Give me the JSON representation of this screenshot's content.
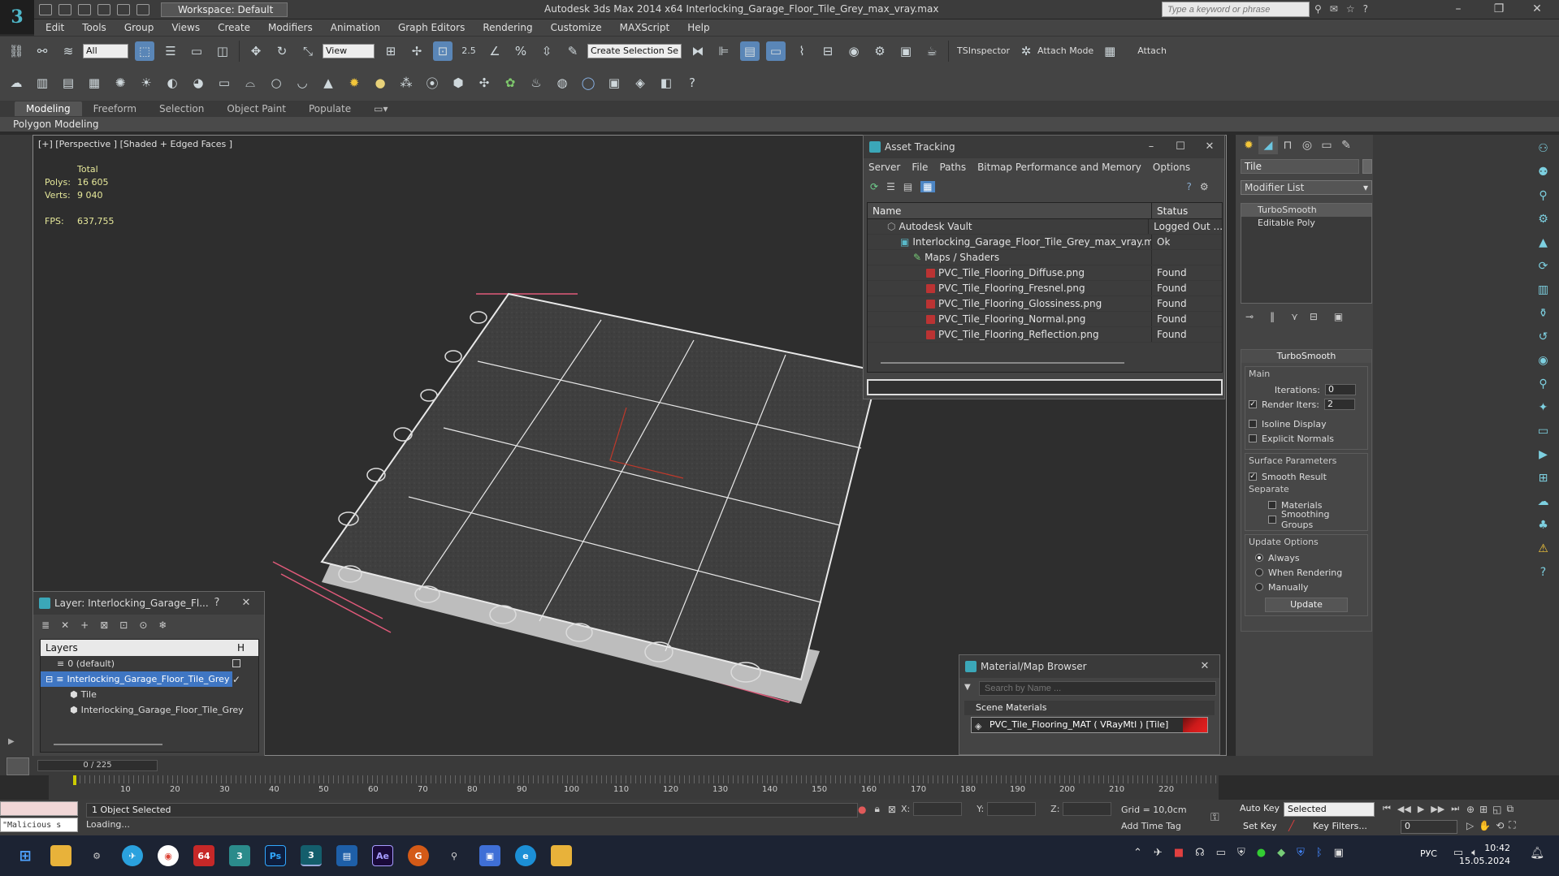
{
  "app": {
    "title": "Autodesk 3ds Max  2014 x64    Interlocking_Garage_Floor_Tile_Grey_max_vray.max",
    "workspace": "Workspace: Default",
    "search_placeholder": "Type a keyword or phrase"
  },
  "menu": [
    "Edit",
    "Tools",
    "Group",
    "Views",
    "Create",
    "Modifiers",
    "Animation",
    "Graph Editors",
    "Rendering",
    "Customize",
    "MAXScript",
    "Help"
  ],
  "toolbar": {
    "selection_filter": "All",
    "ref_coord": "View",
    "named_selection": "Create Selection Se",
    "snap_label": "2.5",
    "tsinspector": "TSInspector",
    "attach_mode": "Attach Mode",
    "attach": "Attach"
  },
  "ribbon": {
    "tabs": [
      "Modeling",
      "Freeform",
      "Selection",
      "Object Paint",
      "Populate"
    ],
    "active": "Modeling",
    "panel": "Polygon Modeling"
  },
  "viewport": {
    "label": "[+] [Perspective ] [Shaded + Edged Faces ]",
    "stats": {
      "header": "Total",
      "polys_label": "Polys:",
      "polys": "16 605",
      "verts_label": "Verts:",
      "verts": "9 040",
      "fps_label": "FPS:",
      "fps": "637,755"
    }
  },
  "asset_tracking": {
    "title": "Asset Tracking",
    "menu": [
      "Server",
      "File",
      "Paths",
      "Bitmap Performance and Memory",
      "Options"
    ],
    "columns": [
      "Name",
      "Status"
    ],
    "rows": [
      {
        "name": "Autodesk Vault",
        "status": "Logged Out ...",
        "indent": 1,
        "icon": "vault-icon"
      },
      {
        "name": "Interlocking_Garage_Floor_Tile_Grey_max_vray.max",
        "status": "Ok",
        "indent": 2,
        "icon": "max-file-icon"
      },
      {
        "name": "Maps / Shaders",
        "status": "",
        "indent": 3,
        "icon": "maps-icon"
      },
      {
        "name": "PVC_Tile_Flooring_Diffuse.png",
        "status": "Found",
        "indent": 4,
        "icon": "png-icon"
      },
      {
        "name": "PVC_Tile_Flooring_Fresnel.png",
        "status": "Found",
        "indent": 4,
        "icon": "png-icon"
      },
      {
        "name": "PVC_Tile_Flooring_Glossiness.png",
        "status": "Found",
        "indent": 4,
        "icon": "png-icon"
      },
      {
        "name": "PVC_Tile_Flooring_Normal.png",
        "status": "Found",
        "indent": 4,
        "icon": "png-icon"
      },
      {
        "name": "PVC_Tile_Flooring_Reflection.png",
        "status": "Found",
        "indent": 4,
        "icon": "png-icon"
      }
    ]
  },
  "command_panel": {
    "object_name": "Tile",
    "modifier_list": "Modifier List",
    "stack": [
      "TurboSmooth",
      "Editable Poly"
    ],
    "rollout_title": "TurboSmooth",
    "main_group": "Main",
    "iterations_label": "Iterations:",
    "iterations": "0",
    "render_iters_label": "Render Iters:",
    "render_iters": "2",
    "isoline": "Isoline Display",
    "explicit_normals": "Explicit Normals",
    "surface_group": "Surface Parameters",
    "smooth_result": "Smooth Result",
    "separate_label": "Separate",
    "materials": "Materials",
    "smoothing_groups": "Smoothing Groups",
    "update_group": "Update Options",
    "always": "Always",
    "when_rendering": "When Rendering",
    "manually": "Manually",
    "update_button": "Update"
  },
  "layer_window": {
    "title": "Layer: Interlocking_Garage_Fl...",
    "help": "?",
    "header": "Layers",
    "header_col2": "H",
    "rows": [
      {
        "name": "0 (default)",
        "indent": 1
      },
      {
        "name": "Interlocking_Garage_Floor_Tile_Grey",
        "indent": 1
      },
      {
        "name": "Tile",
        "indent": 2
      },
      {
        "name": "Interlocking_Garage_Floor_Tile_Grey",
        "indent": 2
      }
    ]
  },
  "material_browser": {
    "title": "Material/Map Browser",
    "search_placeholder": "Search by Name ...",
    "section": "Scene Materials",
    "item": "PVC_Tile_Flooring_MAT ( VRayMtl ) [Tile]"
  },
  "timeline": {
    "frame_display": "0 / 225",
    "ticks": [
      "10",
      "20",
      "30",
      "40",
      "50",
      "60",
      "70",
      "80",
      "90",
      "100",
      "110",
      "120",
      "130",
      "140",
      "150",
      "160",
      "170",
      "180",
      "190",
      "200",
      "210",
      "220"
    ]
  },
  "status": {
    "selection": "1 Object Selected",
    "prompt": "Loading...",
    "maxscript": "\"Malicious s",
    "x_label": "X:",
    "y_label": "Y:",
    "z_label": "Z:",
    "grid": "Grid = 10,0cm",
    "add_time_tag": "Add Time Tag",
    "auto_key": "Auto Key",
    "set_key": "Set Key",
    "selected": "Selected",
    "key_filters": "Key Filters...",
    "frame": "0"
  },
  "taskbar": {
    "lang": "РУС",
    "time": "10:42",
    "date": "15.05.2024",
    "badge": "64",
    "ps": "Ps",
    "ae": "Ae"
  }
}
